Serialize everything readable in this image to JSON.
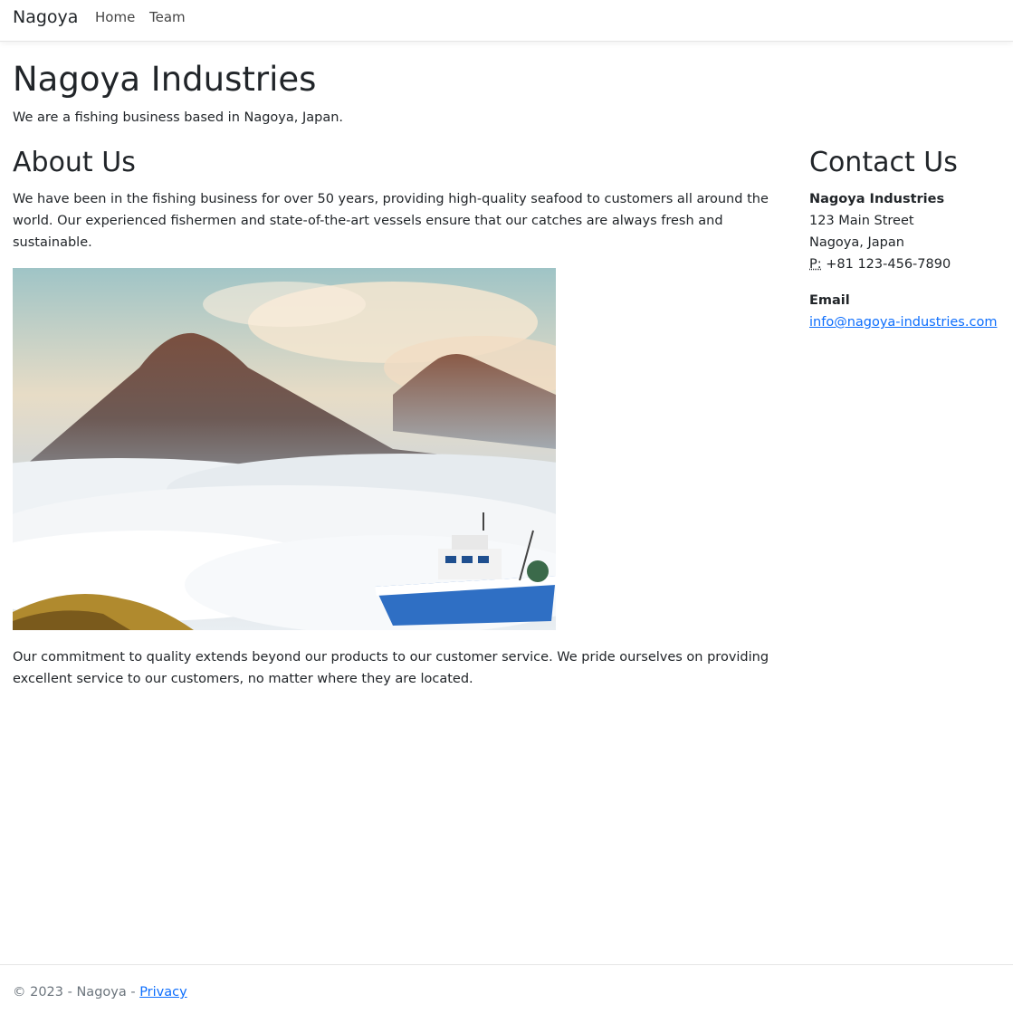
{
  "nav": {
    "brand": "Nagoya",
    "links": [
      {
        "label": "Home"
      },
      {
        "label": "Team"
      }
    ]
  },
  "hero": {
    "title": "Nagoya Industries",
    "lead": "We are a fishing business based in Nagoya, Japan."
  },
  "about": {
    "heading": "About Us",
    "paragraph1": "We have been in the fishing business for over 50 years, providing high-quality seafood to customers all around the world. Our experienced fishermen and state-of-the-art vessels ensure that our catches are always fresh and sustainable.",
    "image_icon": "mountains-over-clouds-with-fishing-boat-image",
    "paragraph2": "Our commitment to quality extends beyond our products to our customer service. We pride ourselves on providing excellent service to our customers, no matter where they are located."
  },
  "contact": {
    "heading": "Contact Us",
    "company": "Nagoya Industries",
    "street": "123 Main Street",
    "city": "Nagoya, Japan",
    "phone_label": "P:",
    "phone": "+81 123-456-7890",
    "email_label": "Email",
    "email": "info@nagoya-industries.com"
  },
  "footer": {
    "copyright": "© 2023 - Nagoya - ",
    "privacy": "Privacy"
  },
  "colors": {
    "link": "#0d6efd",
    "text": "#212529",
    "muted": "#6c757d"
  }
}
